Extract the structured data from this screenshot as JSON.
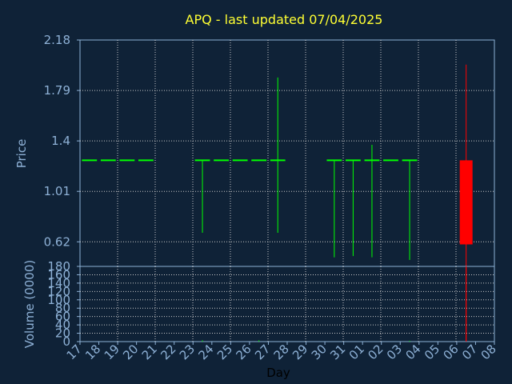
{
  "chart_data": {
    "type": "candlestick",
    "title": "APQ - last updated 07/04/2025",
    "price_axis": {
      "label": "Price",
      "ylim": [
        0.43,
        2.18
      ],
      "ticks": [
        "2.18",
        "1.79",
        "1.4",
        "1.01",
        "0.62"
      ]
    },
    "volume_axis": {
      "label": "Volume (0000)",
      "ylim": [
        0,
        180
      ],
      "ticks": [
        "180",
        "160",
        "140",
        "120",
        "100",
        "80",
        "60",
        "40",
        "20",
        "0"
      ]
    },
    "x_axis": {
      "label": "Day",
      "ticks": [
        "17",
        "18",
        "19",
        "20",
        "21",
        "22",
        "23",
        "24",
        "25",
        "26",
        "27",
        "28",
        "29",
        "30",
        "31",
        "01",
        "02",
        "03",
        "04",
        "05",
        "06",
        "07",
        "08"
      ]
    },
    "grid": true,
    "candles": [
      {
        "day": "17",
        "open": 1.25,
        "high": 1.25,
        "low": 1.25,
        "close": 1.25,
        "volume": 0,
        "color": "#00ff00"
      },
      {
        "day": "18",
        "open": 1.25,
        "high": 1.25,
        "low": 1.25,
        "close": 1.25,
        "volume": 0,
        "color": "#00ff00"
      },
      {
        "day": "19",
        "open": 1.25,
        "high": 1.25,
        "low": 1.25,
        "close": 1.25,
        "volume": 0,
        "color": "#00ff00"
      },
      {
        "day": "20",
        "open": 1.25,
        "high": 1.25,
        "low": 1.25,
        "close": 1.25,
        "volume": 0,
        "color": "#00ff00"
      },
      {
        "day": "23",
        "open": 1.25,
        "high": 1.25,
        "low": 0.69,
        "close": 1.25,
        "volume": 3,
        "color": "#00ff00"
      },
      {
        "day": "24",
        "open": 1.25,
        "high": 1.25,
        "low": 1.25,
        "close": 1.25,
        "volume": 0,
        "color": "#00ff00"
      },
      {
        "day": "25",
        "open": 1.25,
        "high": 1.25,
        "low": 1.25,
        "close": 1.25,
        "volume": 0,
        "color": "#00ff00"
      },
      {
        "day": "26",
        "open": 1.25,
        "high": 1.25,
        "low": 1.25,
        "close": 1.25,
        "volume": 3,
        "color": "#00ff00"
      },
      {
        "day": "27",
        "open": 1.25,
        "high": 1.89,
        "low": 0.69,
        "close": 1.25,
        "volume": 0,
        "color": "#00ff00"
      },
      {
        "day": "30",
        "open": 1.25,
        "high": 1.25,
        "low": 0.5,
        "close": 1.25,
        "volume": 0,
        "color": "#00ff00"
      },
      {
        "day": "31",
        "open": 1.25,
        "high": 1.25,
        "low": 0.51,
        "close": 1.25,
        "volume": 0,
        "color": "#00ff00"
      },
      {
        "day": "01",
        "open": 1.25,
        "high": 1.37,
        "low": 0.5,
        "close": 1.25,
        "volume": 0,
        "color": "#00ff00"
      },
      {
        "day": "02",
        "open": 1.25,
        "high": 1.25,
        "low": 1.25,
        "close": 1.25,
        "volume": 0,
        "color": "#00ff00"
      },
      {
        "day": "03",
        "open": 1.25,
        "high": 1.25,
        "low": 0.48,
        "close": 1.25,
        "volume": 2,
        "color": "#00ff00"
      },
      {
        "day": "06",
        "open": 1.25,
        "high": 1.99,
        "low": 0.43,
        "close": 0.6,
        "volume": 180,
        "color": "#ff0000"
      }
    ]
  },
  "colors": {
    "background": "#0f2237",
    "grid": "#c8c8c8",
    "axis": "#8eb1d6",
    "title": "#ffff33",
    "up": "#00ff00",
    "down": "#ff0000"
  }
}
